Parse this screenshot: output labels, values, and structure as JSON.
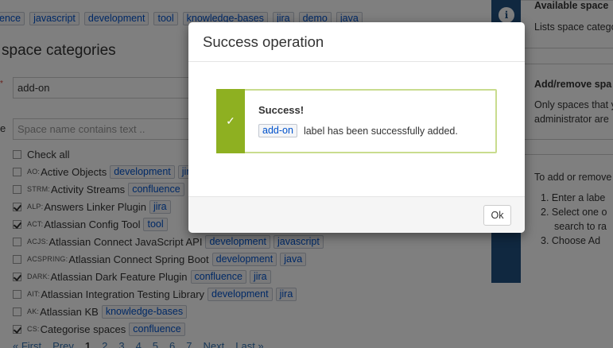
{
  "top_tags": [
    "ence",
    "javascript",
    "development",
    "tool",
    "knowledge-bases",
    "jira",
    "demo",
    "java"
  ],
  "section_heading": "space categories",
  "label_field": {
    "required_mark": "*",
    "value": "add-on"
  },
  "filter_prefix": "e",
  "filter_field": {
    "placeholder": "Space name contains text .."
  },
  "check_all": "Check all",
  "spaces": [
    {
      "checked": false,
      "key": "AO:",
      "name": "Active Objects",
      "labels": [
        "development",
        "jir"
      ]
    },
    {
      "checked": false,
      "key": "STRM:",
      "name": "Activity Streams",
      "labels": [
        "confluence"
      ]
    },
    {
      "checked": true,
      "key": "ALP:",
      "name": "Answers Linker Plugin",
      "labels": [
        "jira"
      ]
    },
    {
      "checked": true,
      "key": "ACT:",
      "name": "Atlassian Config Tool",
      "labels": [
        "tool"
      ]
    },
    {
      "checked": false,
      "key": "ACJS:",
      "name": "Atlassian Connect JavaScript API",
      "labels": [
        "development",
        "javascript"
      ]
    },
    {
      "checked": false,
      "key": "ACSPRING:",
      "name": "Atlassian Connect Spring Boot",
      "labels": [
        "development",
        "java"
      ]
    },
    {
      "checked": true,
      "key": "DARK:",
      "name": "Atlassian Dark Feature Plugin",
      "labels": [
        "confluence",
        "jira"
      ]
    },
    {
      "checked": false,
      "key": "AIT:",
      "name": "Atlassian Integration Testing Library",
      "labels": [
        "development",
        "jira"
      ]
    },
    {
      "checked": false,
      "key": "AK:",
      "name": "Atlassian KB",
      "labels": [
        "knowledge-bases"
      ]
    },
    {
      "checked": true,
      "key": "CS:",
      "name": "Categorise spaces",
      "labels": [
        "confluence"
      ]
    }
  ],
  "pagination": {
    "first": "« First",
    "prev": "Prev",
    "pages": [
      "1",
      "2",
      "3",
      "4",
      "5",
      "6",
      "7"
    ],
    "current": "1",
    "next": "Next",
    "last": "Last »"
  },
  "sidebar": {
    "info_icon": "i",
    "section1_title": "Available space",
    "section1_text": "Lists space catego",
    "section2_title": "Add/remove spa",
    "section2_text": [
      "Only spaces that y",
      "administrator are"
    ],
    "section3_text": "To add or remove",
    "steps": [
      "1. Enter a labe",
      "2. Select one o",
      "search to ra",
      "3. Choose Ad"
    ]
  },
  "modal": {
    "title": "Success operation",
    "success_title": "Success!",
    "label": "add-on",
    "message": "label has been successfully added.",
    "check_icon": "✓",
    "ok_label": "Ok"
  },
  "colors": {
    "success_green": "#8eb021",
    "sidebar_blue": "#205081",
    "link": "#3572b0",
    "label_text": "#0052cc"
  }
}
